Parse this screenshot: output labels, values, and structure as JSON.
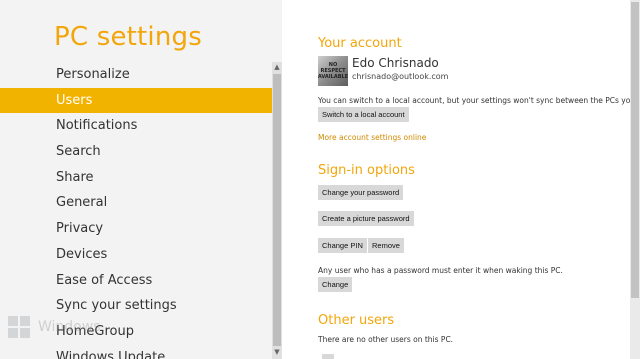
{
  "app": {
    "title": "PC settings"
  },
  "nav": {
    "items": [
      {
        "label": "Personalize"
      },
      {
        "label": "Users"
      },
      {
        "label": "Notifications"
      },
      {
        "label": "Search"
      },
      {
        "label": "Share"
      },
      {
        "label": "General"
      },
      {
        "label": "Privacy"
      },
      {
        "label": "Devices"
      },
      {
        "label": "Ease of Access"
      },
      {
        "label": "Sync your settings"
      },
      {
        "label": "HomeGroup"
      },
      {
        "label": "Windows Update"
      }
    ],
    "selected_index": 1
  },
  "watermark": {
    "text": "Windows"
  },
  "account": {
    "section_title": "Your account",
    "user_name": "Edo Chrisnado",
    "user_email": "chrisnado@outlook.com",
    "avatar_text": "NO RESPECT AVAILABLE",
    "description": "You can switch to a local account, but your settings won't sync between the PCs you use.",
    "switch_button": "Switch to a local account",
    "more_link": "More account settings online"
  },
  "signin": {
    "section_title": "Sign-in options",
    "change_password": "Change your password",
    "picture_password": "Create a picture password",
    "change_pin": "Change PIN",
    "remove": "Remove",
    "note": "Any user who has a password must enter it when waking this PC.",
    "change": "Change"
  },
  "other_users": {
    "section_title": "Other users",
    "note": "There are no other users on this PC."
  },
  "colors": {
    "accent": "#f2b200",
    "title": "#f2a60a",
    "link": "#d08a00",
    "button": "#d8d8d8"
  }
}
